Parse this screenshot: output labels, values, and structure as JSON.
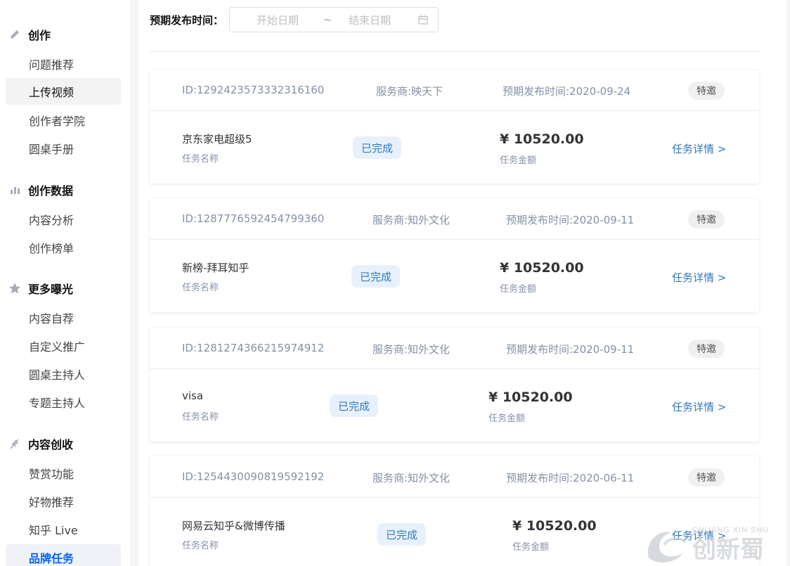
{
  "sidebar": {
    "groups": [
      {
        "title": "创作",
        "icon": "pencil-icon",
        "items": [
          "问题推荐",
          "上传视频",
          "创作者学院",
          "圆桌手册"
        ]
      },
      {
        "title": "创作数据",
        "icon": "chart-icon",
        "items": [
          "内容分析",
          "创作榜单"
        ]
      },
      {
        "title": "更多曝光",
        "icon": "star-icon",
        "items": [
          "内容自荐",
          "自定义推广",
          "圆桌主持人",
          "专题主持人"
        ]
      },
      {
        "title": "内容创收",
        "icon": "wheat-icon",
        "items": [
          "赞赏功能",
          "好物推荐",
          "知乎 Live",
          "品牌任务"
        ]
      }
    ],
    "hover_item": "上传视频",
    "active_item": "品牌任务"
  },
  "filter": {
    "label": "预期发布时间：",
    "start_placeholder": "开始日期",
    "separator": "~",
    "end_placeholder": "结束日期"
  },
  "tasks": [
    {
      "id": "ID:1292423573332316160",
      "provider": "服务商:映天下",
      "date": "预期发布时间:2020-09-24",
      "badge": "特邀",
      "name": "京东家电超级5",
      "name_label": "任务名称",
      "status": "已完成",
      "amount": "¥ 10520.00",
      "amount_label": "任务金额",
      "link": "任务详情 >"
    },
    {
      "id": "ID:1287776592454799360",
      "provider": "服务商:知外文化",
      "date": "预期发布时间:2020-09-11",
      "badge": "特邀",
      "name": "新榜-拜耳知乎",
      "name_label": "任务名称",
      "status": "已完成",
      "amount": "¥ 10520.00",
      "amount_label": "任务金额",
      "link": "任务详情 >"
    },
    {
      "id": "ID:1281274366215974912",
      "provider": "服务商:知外文化",
      "date": "预期发布时间:2020-09-11",
      "badge": "特邀",
      "name": "visa",
      "name_label": "任务名称",
      "status": "已完成",
      "amount": "¥ 10520.00",
      "amount_label": "任务金额",
      "link": "任务详情 >"
    },
    {
      "id": "ID:1254430090819592192",
      "provider": "服务商:知外文化",
      "date": "预期发布时间:2020-06-11",
      "badge": "特邀",
      "name": "网易云知乎&微博传播",
      "name_label": "任务名称",
      "status": "已完成",
      "amount": "¥ 10520.00",
      "amount_label": "任务金额",
      "link": "任务详情 >"
    }
  ],
  "watermark": {
    "line1": "CHUANG XIN SHU",
    "line2": "创新蜀"
  },
  "colors": {
    "link": "#3578b6",
    "status_bg": "#e8f1fb",
    "status_text": "#2e7bbf",
    "active": "#0066ff"
  }
}
